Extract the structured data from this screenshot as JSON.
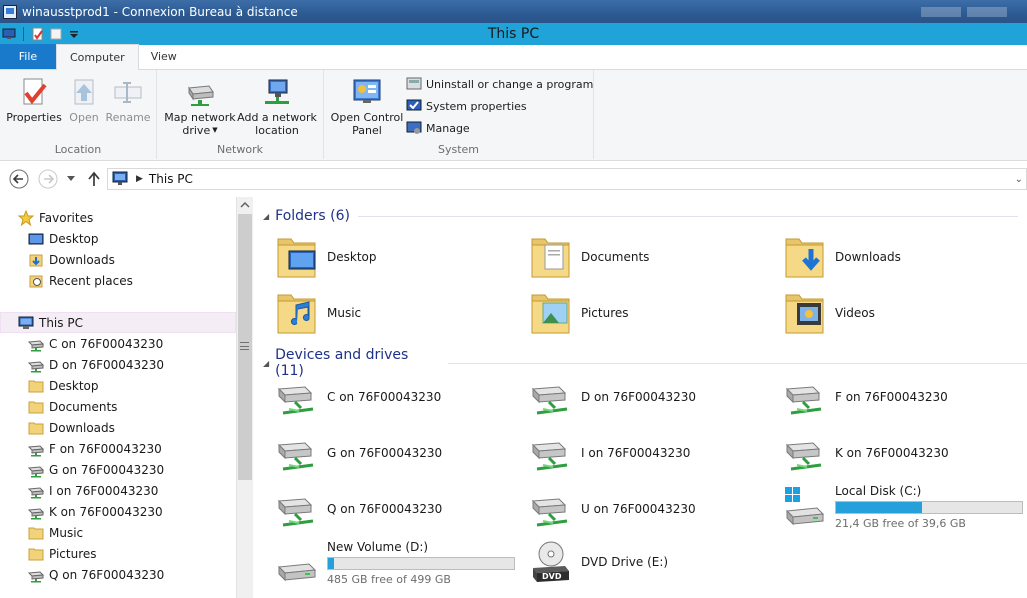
{
  "rdp": {
    "title": "winausstprod1 - Connexion Bureau à distance"
  },
  "window": {
    "title": "This PC"
  },
  "ribbon": {
    "tabs": [
      {
        "label": "File"
      },
      {
        "label": "Computer"
      },
      {
        "label": "View"
      }
    ],
    "groups": {
      "location": {
        "label": "Location",
        "properties": "Properties",
        "open": "Open",
        "rename": "Rename"
      },
      "network": {
        "label": "Network",
        "map_drive_line1": "Map network",
        "map_drive_line2": "drive",
        "add_location_line1": "Add a network",
        "add_location_line2": "location"
      },
      "system": {
        "label": "System",
        "open_cp_line1": "Open Control",
        "open_cp_line2": "Panel",
        "uninstall": "Uninstall or change a program",
        "system_properties": "System properties",
        "manage": "Manage"
      }
    }
  },
  "address": {
    "path": "This PC"
  },
  "tree": {
    "favorites": {
      "label": "Favorites",
      "items": [
        "Desktop",
        "Downloads",
        "Recent places"
      ]
    },
    "this_pc": {
      "label": "This PC",
      "items": [
        {
          "label": "C on 76F00043230",
          "icon": "network-drive-icon"
        },
        {
          "label": "D on 76F00043230",
          "icon": "network-drive-icon"
        },
        {
          "label": "Desktop",
          "icon": "folder-icon"
        },
        {
          "label": "Documents",
          "icon": "folder-icon"
        },
        {
          "label": "Downloads",
          "icon": "folder-icon"
        },
        {
          "label": "F on 76F00043230",
          "icon": "network-drive-icon"
        },
        {
          "label": "G on 76F00043230",
          "icon": "network-drive-icon"
        },
        {
          "label": "I on 76F00043230",
          "icon": "network-drive-icon"
        },
        {
          "label": "K on 76F00043230",
          "icon": "network-drive-icon"
        },
        {
          "label": "Music",
          "icon": "folder-icon"
        },
        {
          "label": "Pictures",
          "icon": "folder-icon"
        },
        {
          "label": "Q on 76F00043230",
          "icon": "network-drive-icon"
        }
      ]
    }
  },
  "content": {
    "folders": {
      "heading": "Folders (6)",
      "items": [
        "Desktop",
        "Documents",
        "Downloads",
        "Music",
        "Pictures",
        "Videos"
      ]
    },
    "drives": {
      "heading": "Devices and drives (11)",
      "network": [
        "C on 76F00043230",
        "D on 76F00043230",
        "F on 76F00043230",
        "G on 76F00043230",
        "I on 76F00043230",
        "K on 76F00043230",
        "Q on 76F00043230",
        "U on 76F00043230"
      ],
      "local_c": {
        "label": "Local Disk (C:)",
        "free": "21,4 GB free of 39,6 GB",
        "used_fraction": 0.46
      },
      "volume_d": {
        "label": "New Volume (D:)",
        "free": "485 GB free of 499 GB",
        "used_fraction": 0.03
      },
      "dvd": {
        "label": "DVD Drive (E:)",
        "badge": "DVD"
      }
    }
  },
  "colors": {
    "title_blue": "#1fa3d8",
    "file_tab": "#1979ca",
    "heading": "#1e3287",
    "bar_fill": "#26a0da"
  }
}
